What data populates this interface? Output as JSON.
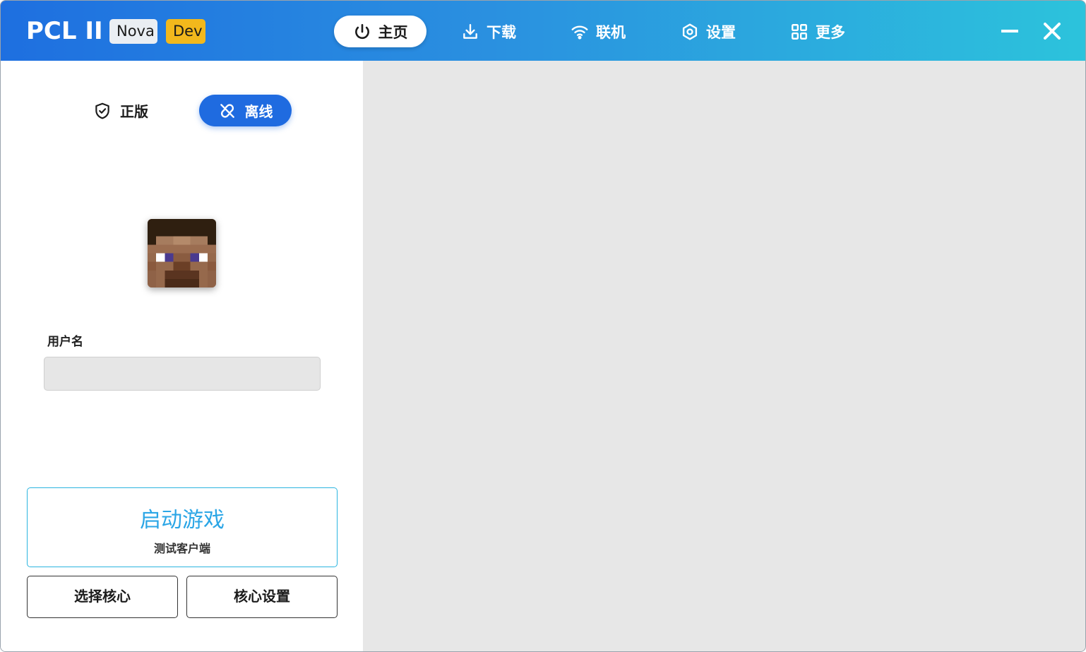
{
  "app": {
    "logo": "PCL II",
    "badges": {
      "nova": "Nova",
      "dev": "Dev"
    },
    "colors": {
      "accent": "#1f6be0",
      "gradient_start": "#1e6fe0",
      "gradient_end": "#2cc3dc",
      "dev_badge": "#f2b81c"
    }
  },
  "nav": {
    "home": {
      "label": "主页",
      "icon": "power-icon"
    },
    "download": {
      "label": "下载",
      "icon": "download-icon"
    },
    "online": {
      "label": "联机",
      "icon": "wifi-icon"
    },
    "settings": {
      "label": "设置",
      "icon": "gear-icon"
    },
    "more": {
      "label": "更多",
      "icon": "grid-icon"
    }
  },
  "window": {
    "minimize_icon": "minimize-icon",
    "close_icon": "close-icon"
  },
  "auth": {
    "official": {
      "label": "正版",
      "icon": "shield-check-icon"
    },
    "offline": {
      "label": "离线",
      "icon": "link-broken-icon",
      "selected": true
    }
  },
  "user": {
    "username_label": "用户名",
    "username_value": ""
  },
  "launch": {
    "title": "启动游戏",
    "subtitle": "测试客户端"
  },
  "buttons": {
    "select_core": "选择核心",
    "core_settings": "核心设置"
  }
}
